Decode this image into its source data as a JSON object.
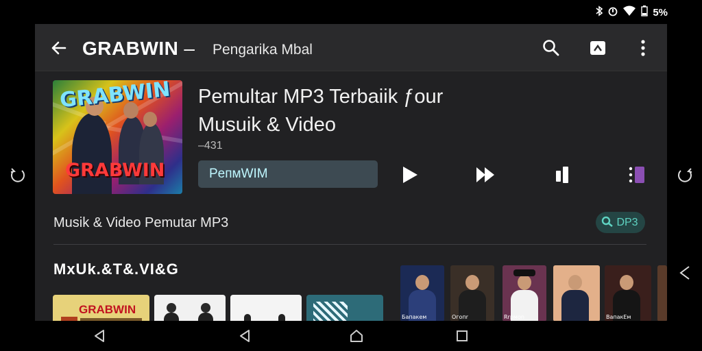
{
  "status_bar": {
    "battery_text": "5%"
  },
  "app_bar": {
    "title": "GRABWIN",
    "separator": "–",
    "subtitle": "Pengarika Mbal"
  },
  "album": {
    "art_text_top": "GRABWIN",
    "art_text_bottom": "GRABWIN"
  },
  "track": {
    "title": "Pemultar MP3 Terbaiik ƒour Musuik & Video",
    "meta": "–431",
    "input_value": "PeпмWIM"
  },
  "section": {
    "label": "Musik & Video Pemutar MP3",
    "chip_label": "DP3"
  },
  "grid": {
    "title": "MxUk.&T&.VI&G",
    "cards": [
      {
        "label": "GRABWIN",
        "bg": "#e7d27a"
      },
      {
        "label": "",
        "bg": "#f1f1f1"
      },
      {
        "label": "",
        "bg": "#f4f4f4"
      },
      {
        "label": "",
        "bg": "#2d6b78"
      }
    ],
    "thumbs": [
      {
        "caption": "Бaпакем",
        "bg": "#1b2a55"
      },
      {
        "caption": "Oгoпr",
        "bg": "#3a2f27"
      },
      {
        "caption": "Rrpмon",
        "bg": "#6a3350"
      },
      {
        "caption": "",
        "bg": "#e3b08a"
      },
      {
        "caption": "ВaпaкЕм",
        "bg": "#3a1f1c"
      }
    ]
  },
  "colors": {
    "accent": "#5fd3c2",
    "app_bg": "#212123",
    "topbar_bg": "#2a2a2c",
    "input_bg": "#3d4a52"
  }
}
